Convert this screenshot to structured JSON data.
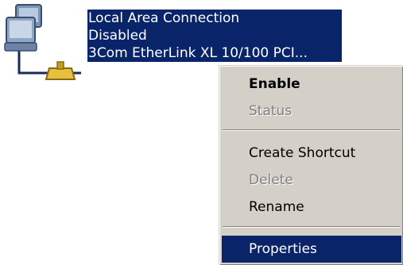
{
  "connection": {
    "name": "Local Area Connection",
    "status": "Disabled",
    "device": "3Com EtherLink XL 10/100 PCI..."
  },
  "context_menu": {
    "enable": "Enable",
    "status": "Status",
    "create_shortcut": "Create Shortcut",
    "delete": "Delete",
    "rename": "Rename",
    "properties": "Properties"
  },
  "colors": {
    "selection": "#0a246a",
    "menu_background": "#d4d0c8",
    "disabled_text": "#808080"
  }
}
